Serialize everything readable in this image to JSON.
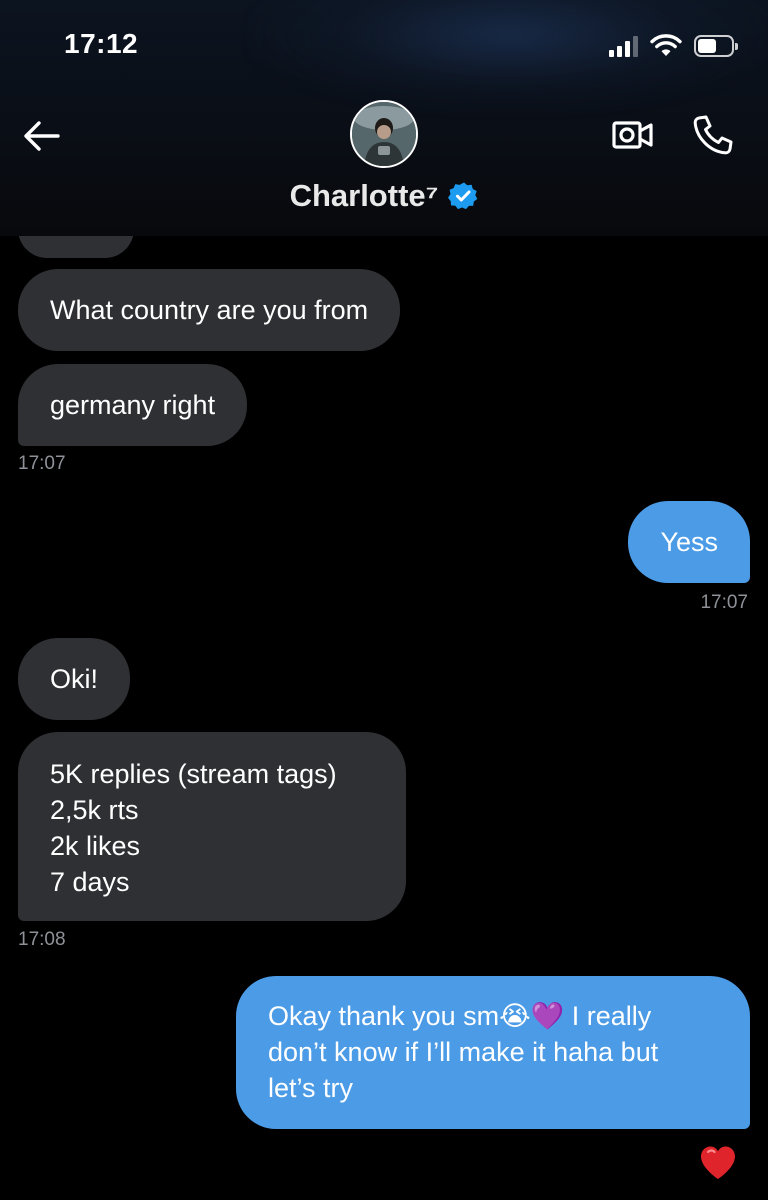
{
  "status_bar": {
    "time": "17:12",
    "battery_level": 0.55
  },
  "header": {
    "contact_name": "Charlotte⁷",
    "verified": true,
    "icons": {
      "back": "back-arrow-icon",
      "video": "video-call-icon",
      "call": "phone-icon",
      "verified": "verified-badge-icon"
    }
  },
  "colors": {
    "incoming_bubble": "#2f3034",
    "outgoing_bubble": "#4b9be6",
    "verified_badge": "#1d9bf0",
    "timestamp": "#8e9298",
    "background": "#000000"
  },
  "messages": [
    {
      "direction": "in",
      "text": ""
    },
    {
      "direction": "in",
      "text": "What country are you from"
    },
    {
      "direction": "in",
      "text": "germany right",
      "timestamp": "17:07"
    },
    {
      "direction": "out",
      "text": "Yess",
      "timestamp": "17:07"
    },
    {
      "direction": "in",
      "text": "Oki!"
    },
    {
      "direction": "in",
      "text": "5K replies (stream tags)\n2,5k rts\n2k likes\n7 days",
      "timestamp": "17:08"
    },
    {
      "direction": "out",
      "text": "Okay thank you sm😭💜 I really\ndon’t know if I’ll make it haha but\nlet’s try",
      "reaction": "❤️"
    }
  ]
}
